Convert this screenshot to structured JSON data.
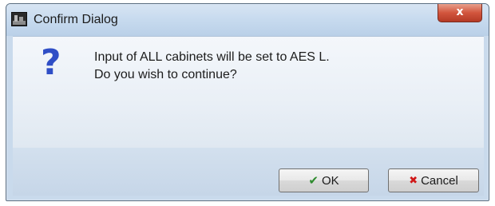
{
  "window": {
    "title": "Confirm Dialog",
    "close_glyph": "x",
    "icon": "app-window-icon"
  },
  "message": {
    "icon": "question-icon",
    "icon_glyph": "?",
    "line1": "Input of ALL cabinets will be set to AES L.",
    "line2": "Do you wish to continue?"
  },
  "buttons": {
    "ok_label": "OK",
    "ok_icon": "check-icon",
    "ok_glyph": "✔",
    "cancel_label": "Cancel",
    "cancel_icon": "x-icon",
    "cancel_glyph": "✖"
  },
  "colors": {
    "question_icon": "#2f4ec6",
    "close_button": "#d2553d",
    "ok_check": "#2e8b2e",
    "cancel_x": "#d01818"
  }
}
